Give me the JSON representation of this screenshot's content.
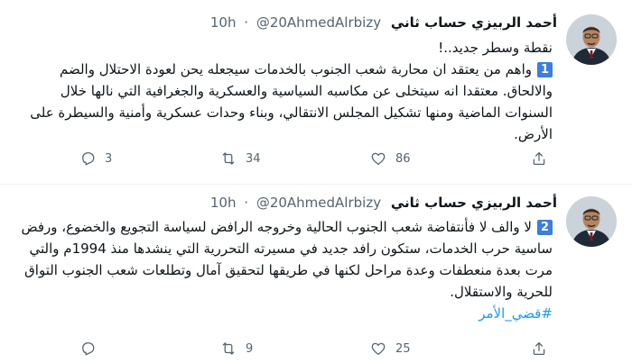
{
  "tweets": [
    {
      "display_name": "أحمد الربيزي حساب ثاني",
      "handle": "@20AhmedAlrbizy",
      "separator": "·",
      "time": "10h",
      "number": "1",
      "text_first": "نقطة وسطر جديد..!",
      "text_main": "واهم من يعتقد ان محاربة شعب الجنوب بالخدمات سيجعله يحن لعودة الاحتلال والضم والالحاق. معتقدا انه سيتخلى عن مكاسبه السياسية والعسكرية والجغرافية التي نالها خلال السنوات الماضية ومنها تشكيل المجلس الانتقالي، وبناء وحدات عسكرية وأمنية والسيطرة على الأرض.",
      "replies": "3",
      "retweets": "34",
      "likes": "86"
    },
    {
      "display_name": "أحمد الربيزي حساب ثاني",
      "handle": "@20AhmedAlrbizy",
      "separator": "·",
      "time": "10h",
      "number": "2",
      "text_main": "لا والف لا فأنتفاضة شعب الجنوب الحالية وخروجه الرافض لسياسة التجويع والخضوع، ورفض ساسية حرب الخدمات، ستكون رافد جديد في مسيرته التحررية التي ينشدها منذ 1994م والتي مرت بعدة منعطفات وعدة مراحل لكنها في طريقها لتحقيق آمال وتطلعات شعب الجنوب التواق للحرية والاستقلال.",
      "hashtag": "#قضي_الأمر",
      "replies": "",
      "retweets": "9",
      "likes": "25"
    }
  ],
  "icons": {
    "reply": "reply-icon",
    "retweet": "retweet-icon",
    "like": "heart-icon",
    "share": "share-icon"
  },
  "colors": {
    "accent": "#1d9bf0",
    "badge": "#3b7de0",
    "muted": "#536471",
    "text": "#0f1419"
  }
}
